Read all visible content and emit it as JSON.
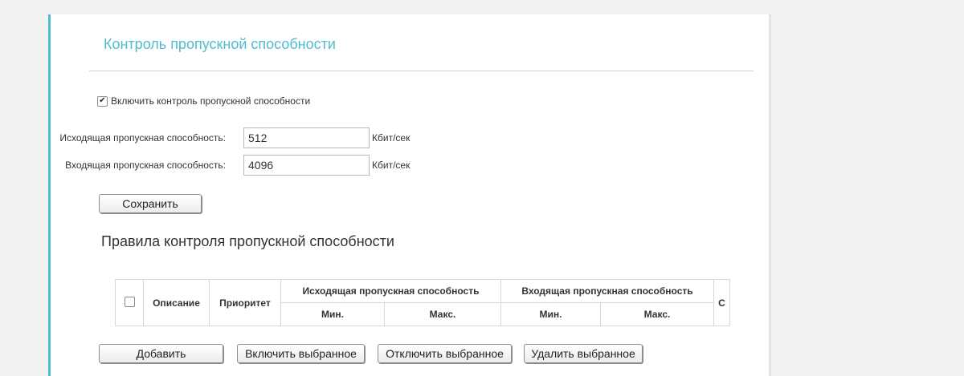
{
  "bandwidth": {
    "title": "Контроль пропускной способности",
    "enable_label": "Включить контроль пропускной способности",
    "enable_checked": true,
    "upstream_label": "Исходящая пропускная способность:",
    "upstream_value": "512",
    "downstream_label": "Входящая пропускная способность:",
    "downstream_value": "4096",
    "unit": "Кбит/сек",
    "save_label": "Сохранить"
  },
  "rules": {
    "title": "Правила контроля пропускной способности",
    "columns": {
      "description": "Описание",
      "priority": "Приоритет",
      "upstream": "Исходящая пропускная способность",
      "downstream": "Входящая пропускная способность",
      "min": "Мин.",
      "max": "Макс.",
      "truncated": "С"
    },
    "buttons": {
      "add": "Добавить",
      "enable_selected": "Включить выбранное",
      "disable_selected": "Отключить выбранное",
      "delete_selected": "Удалить выбранное"
    }
  },
  "colors": {
    "accent": "#4fbccf",
    "background": "#f2f2f2",
    "panel": "#ffffff"
  }
}
